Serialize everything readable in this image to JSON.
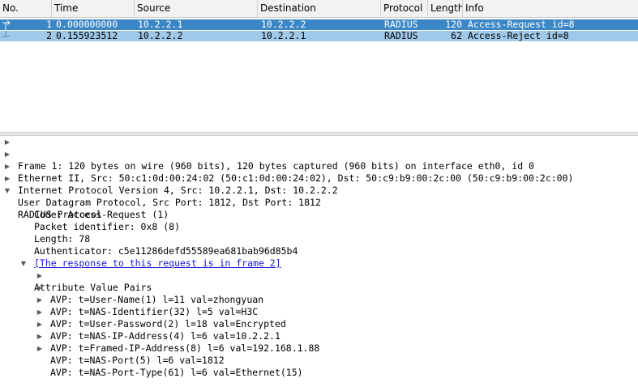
{
  "packet_list": {
    "columns": [
      "No.",
      "Time",
      "Source",
      "Destination",
      "Protocol",
      "Length",
      "Info"
    ],
    "rows": [
      {
        "no": "1",
        "time": "0.000000000",
        "source": "10.2.2.1",
        "destination": "10.2.2.2",
        "protocol": "RADIUS",
        "length": "120",
        "info": "Access-Request id=8",
        "selected": true
      },
      {
        "no": "2",
        "time": "0.155923512",
        "source": "10.2.2.2",
        "destination": "10.2.2.1",
        "protocol": "RADIUS",
        "length": "62",
        "info": "Access-Reject id=8",
        "selected": false
      }
    ]
  },
  "details": {
    "frame": "Frame 1: 120 bytes on wire (960 bits), 120 bytes captured (960 bits) on interface eth0, id 0",
    "ethernet": "Ethernet II, Src: 50:c1:0d:00:24:02 (50:c1:0d:00:24:02), Dst: 50:c9:b9:00:2c:00 (50:c9:b9:00:2c:00)",
    "ip": "Internet Protocol Version 4, Src: 10.2.2.1, Dst: 10.2.2.2",
    "udp": "User Datagram Protocol, Src Port: 1812, Dst Port: 1812",
    "radius": "RADIUS Protocol",
    "code": "Code: Access-Request (1)",
    "packet_id": "Packet identifier: 0x8 (8)",
    "length": "Length: 78",
    "authenticator": "Authenticator: c5e11286defd55589ea681bab96d85b4",
    "response_link": "[The response to this request is in frame 2]",
    "avp_header": "Attribute Value Pairs",
    "avps": [
      "AVP: t=User-Name(1) l=11 val=zhongyuan",
      "AVP: t=NAS-Identifier(32) l=5 val=H3C",
      "AVP: t=User-Password(2) l=18 val=Encrypted",
      "AVP: t=NAS-IP-Address(4) l=6 val=10.2.2.1",
      "AVP: t=Framed-IP-Address(8) l=6 val=192.168.1.88",
      "AVP: t=NAS-Port(5) l=6 val=1812",
      "AVP: t=NAS-Port-Type(61) l=6 val=Ethernet(15)"
    ]
  },
  "colors": {
    "selected_row": "#3b87c6",
    "related_row": "#9fc8e9",
    "link": "#1a1ad6"
  }
}
